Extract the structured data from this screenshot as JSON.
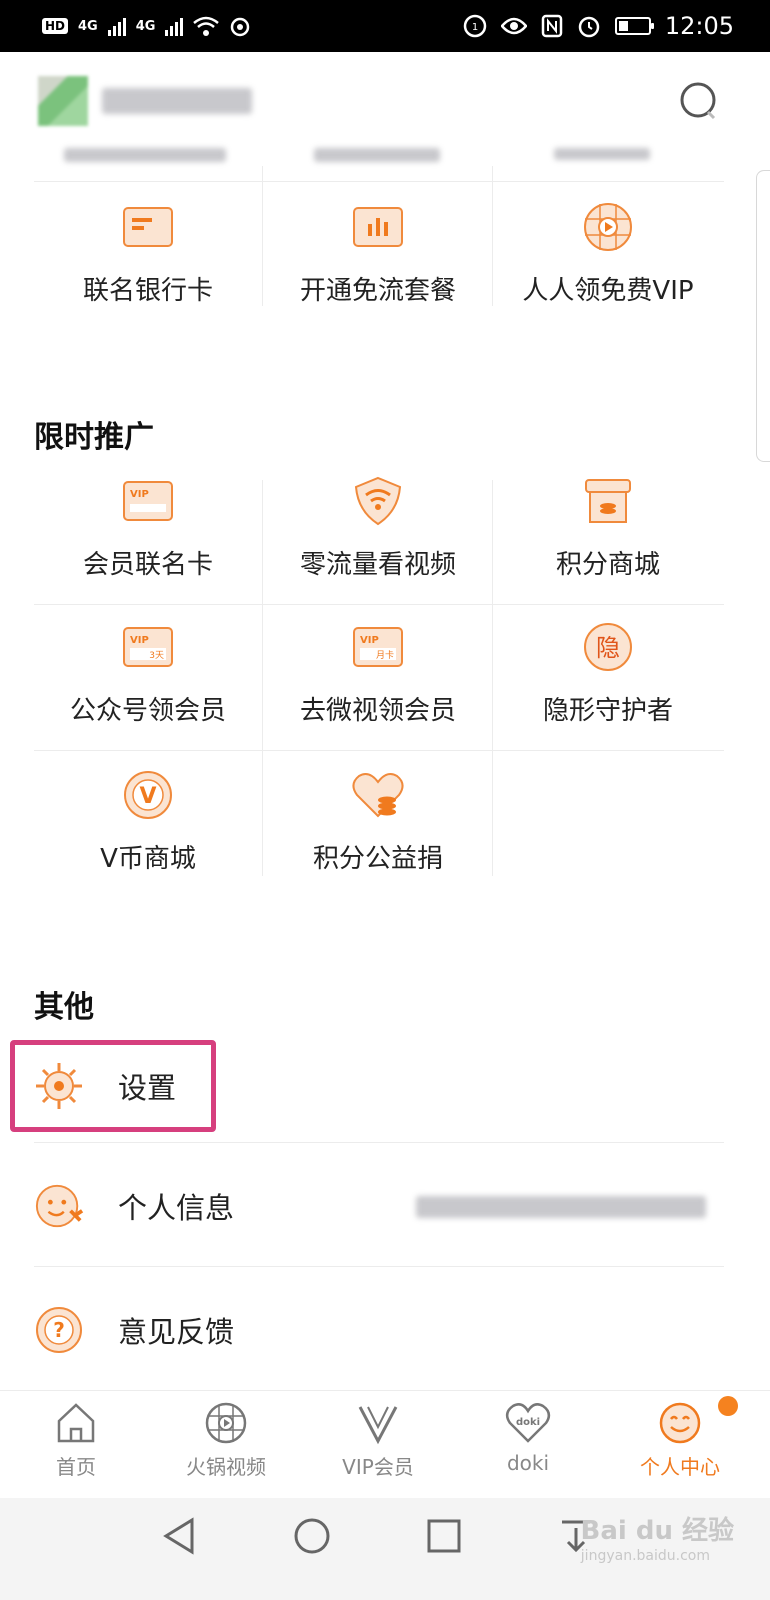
{
  "status_bar": {
    "hd": "HD",
    "net1": "4G",
    "net2": "4G",
    "time": "12:05"
  },
  "quick_grid": [
    {
      "label": "联名银行卡",
      "icon": "bank-card-icon"
    },
    {
      "label": "开通免流套餐",
      "icon": "data-plan-icon"
    },
    {
      "label": "人人领免费VIP",
      "icon": "free-vip-icon"
    }
  ],
  "promo": {
    "title": "限时推广",
    "items": [
      {
        "label": "会员联名卡",
        "icon": "vip-card-icon",
        "badge": "VIP"
      },
      {
        "label": "零流量看视频",
        "icon": "wifi-shield-icon"
      },
      {
        "label": "积分商城",
        "icon": "points-store-icon"
      },
      {
        "label": "公众号领会员",
        "icon": "vip-3day-icon",
        "badge": "VIP",
        "sub": "3天"
      },
      {
        "label": "去微视领会员",
        "icon": "vip-month-icon",
        "badge": "VIP",
        "sub": "月卡"
      },
      {
        "label": "隐形守护者",
        "icon": "invisible-guardian-icon",
        "badge": "隐"
      },
      {
        "label": "V币商城",
        "icon": "vcoin-store-icon",
        "badge": "V"
      },
      {
        "label": "积分公益捐",
        "icon": "charity-heart-icon"
      }
    ]
  },
  "other": {
    "title": "其他",
    "items": [
      {
        "label": "设置",
        "icon": "settings-gear-icon"
      },
      {
        "label": "个人信息",
        "icon": "personal-info-icon"
      },
      {
        "label": "意见反馈",
        "icon": "feedback-question-icon",
        "badge": "?"
      }
    ]
  },
  "bottom_nav": [
    {
      "label": "首页",
      "icon": "home-icon"
    },
    {
      "label": "火锅视频",
      "icon": "video-play-icon"
    },
    {
      "label": "VIP会员",
      "icon": "vip-v-icon"
    },
    {
      "label": "doki",
      "icon": "doki-heart-icon",
      "badge": "doki"
    },
    {
      "label": "个人中心",
      "icon": "smiley-profile-icon",
      "active": true
    }
  ],
  "watermark": {
    "main": "Bai du 经验",
    "sub": "jingyan.baidu.com"
  },
  "colors": {
    "accent": "#f07a1e",
    "icon_fill": "#fbe4d2",
    "highlight": "#d63f7e"
  }
}
